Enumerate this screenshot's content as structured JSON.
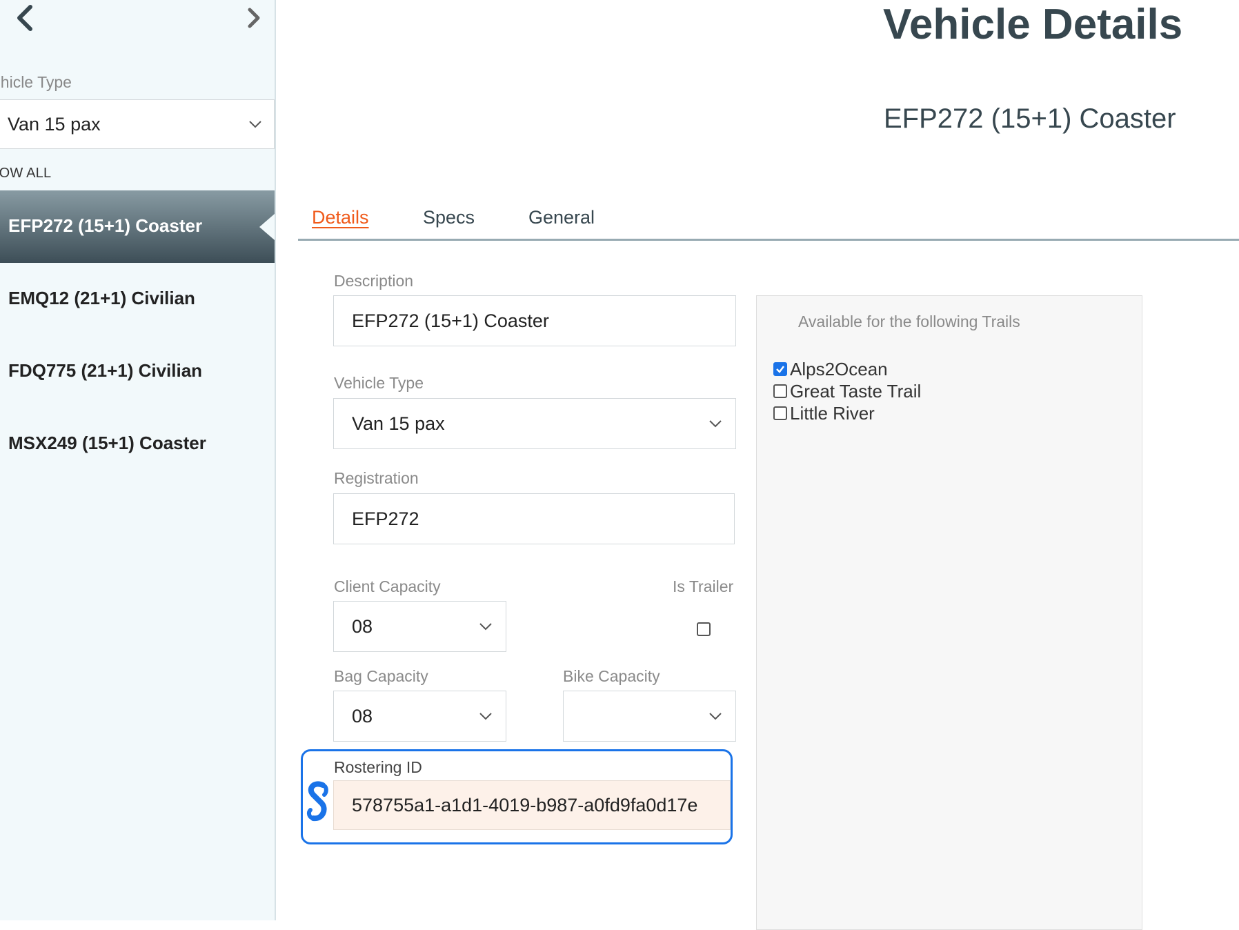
{
  "sidebar": {
    "vehicle_type_label": "ehicle Type",
    "vehicle_type_value": "Van 15 pax",
    "show_all": "HOW ALL",
    "vehicles": [
      "EFP272 (15+1) Coaster",
      "EMQ12 (21+1) Civilian",
      "FDQ775 (21+1) Civilian",
      "MSX249 (15+1) Coaster"
    ],
    "active_index": 0
  },
  "header": {
    "title": "Vehicle Details",
    "vehicle": "EFP272 (15+1) Coaster"
  },
  "tabs": [
    "Details",
    "Specs",
    "General"
  ],
  "active_tab": "Details",
  "form": {
    "description_label": "Description",
    "description_value": "EFP272 (15+1) Coaster",
    "vehicle_type_label": "Vehicle Type",
    "vehicle_type_value": "Van 15 pax",
    "registration_label": "Registration",
    "registration_value": "EFP272",
    "client_capacity_label": "Client Capacity",
    "client_capacity_value": "08",
    "is_trailer_label": "Is Trailer",
    "is_trailer_checked": false,
    "bag_capacity_label": "Bag Capacity",
    "bag_capacity_value": "08",
    "bike_capacity_label": "Bike Capacity",
    "bike_capacity_value": "",
    "rostering_id_label": "Rostering ID",
    "rostering_id_value": "578755a1-a1d1-4019-b987-a0fd9fa0d17e"
  },
  "trails": {
    "title": "Available for the following Trails",
    "items": [
      {
        "label": "Alps2Ocean",
        "checked": true
      },
      {
        "label": "Great Taste Trail",
        "checked": false
      },
      {
        "label": "Little River",
        "checked": false
      }
    ]
  },
  "colors": {
    "accent_tab": "#f05a1a",
    "highlight": "#1a73e8",
    "title": "#37474f"
  }
}
